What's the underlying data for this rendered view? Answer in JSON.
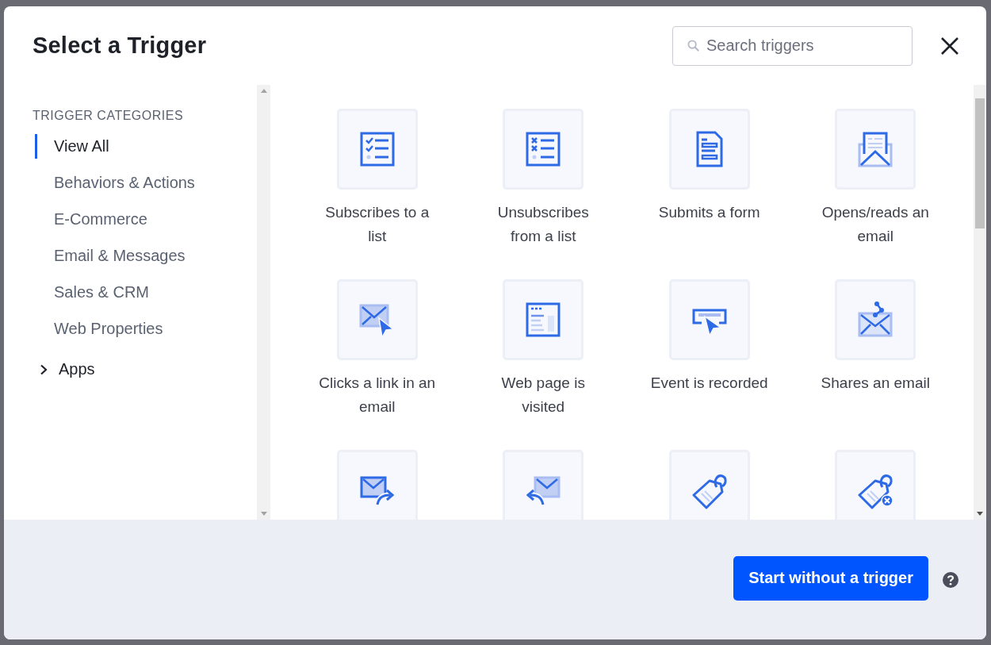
{
  "dialog": {
    "title": "Select a Trigger",
    "search": {
      "placeholder": "Search triggers"
    }
  },
  "sidebar": {
    "heading": "TRIGGER CATEGORIES",
    "items": [
      {
        "label": "View All",
        "selected": true
      },
      {
        "label": "Behaviors & Actions",
        "selected": false
      },
      {
        "label": "E-Commerce",
        "selected": false
      },
      {
        "label": "Email & Messages",
        "selected": false
      },
      {
        "label": "Sales & CRM",
        "selected": false
      },
      {
        "label": "Web Properties",
        "selected": false
      }
    ],
    "groups": [
      {
        "label": "Apps",
        "expanded": false
      }
    ]
  },
  "triggers": [
    {
      "label": "Subscribes to a list"
    },
    {
      "label": "Unsubscribes from a list"
    },
    {
      "label": "Submits a form"
    },
    {
      "label": "Opens/reads an email"
    },
    {
      "label": "Clicks a link in an email"
    },
    {
      "label": "Web page is visited"
    },
    {
      "label": "Event is recorded"
    },
    {
      "label": "Shares an email"
    }
  ],
  "footer": {
    "button": "Start without a trigger"
  }
}
